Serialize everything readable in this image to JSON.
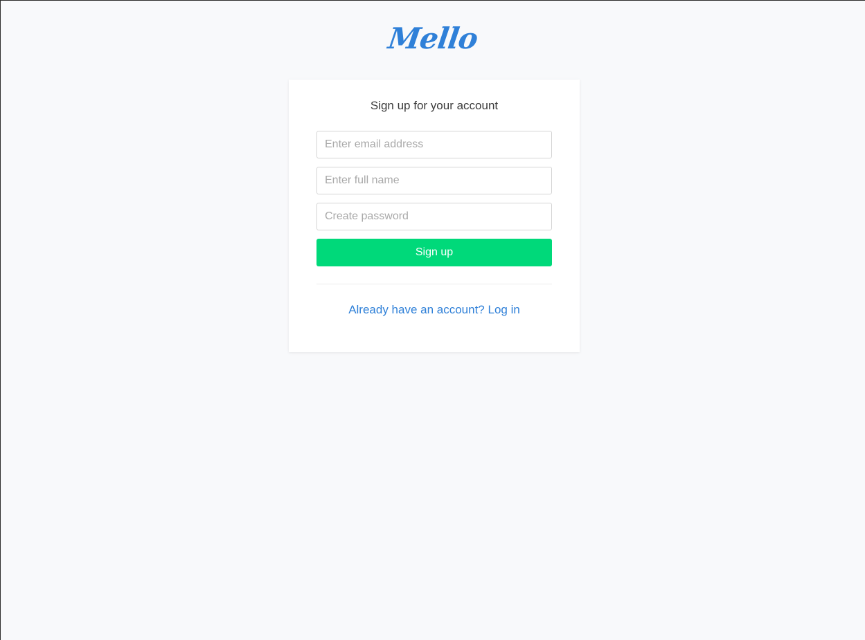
{
  "brand": {
    "logo_text": "Mello",
    "color": "#2f80d8"
  },
  "signup_form": {
    "title": "Sign up for your account",
    "email_placeholder": "Enter email address",
    "email_value": "",
    "name_placeholder": "Enter full name",
    "name_value": "",
    "password_placeholder": "Create password",
    "password_value": "",
    "submit_label": "Sign up",
    "submit_color": "#00d97a",
    "login_link_text": "Already have an account? Log in"
  }
}
